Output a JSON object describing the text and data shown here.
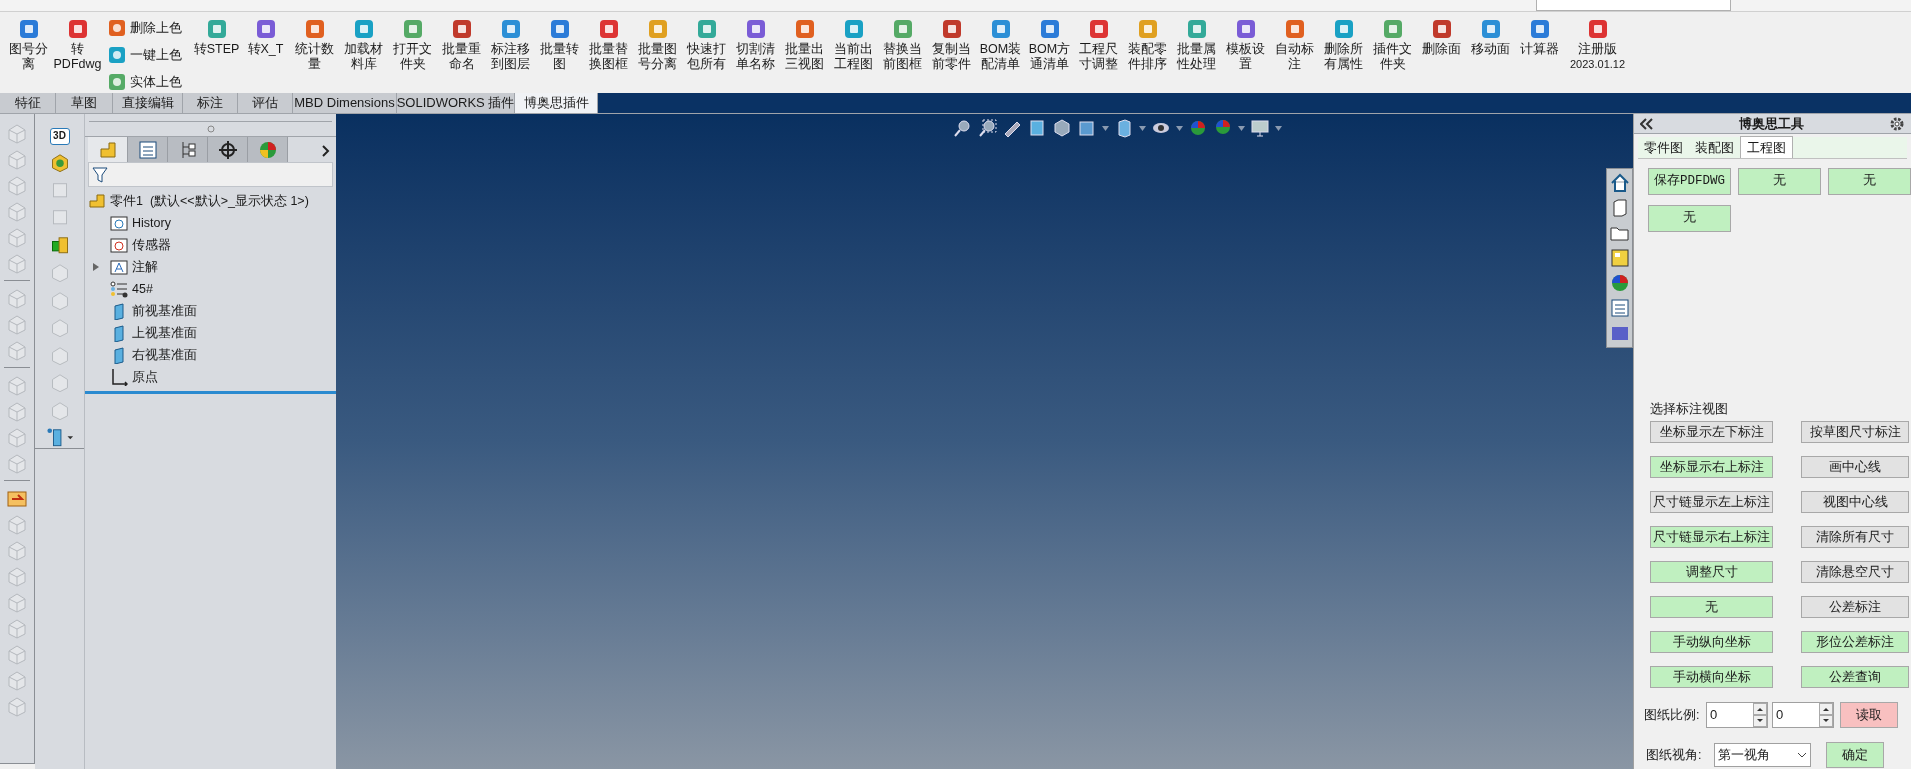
{
  "toolbar": {
    "items": [
      {
        "kind": "large",
        "lines": [
          "图号分",
          "离"
        ]
      },
      {
        "kind": "large",
        "lines": [
          "转",
          "PDFdwg"
        ]
      },
      {
        "kind": "stack",
        "items": [
          {
            "label": "删除上色"
          },
          {
            "label": "一键上色"
          },
          {
            "label": "实体上色"
          }
        ]
      },
      {
        "kind": "large",
        "lines": [
          "转STEP"
        ]
      },
      {
        "kind": "large",
        "lines": [
          "转X_T"
        ]
      },
      {
        "kind": "large",
        "lines": [
          "统计数",
          "量"
        ]
      },
      {
        "kind": "large",
        "lines": [
          "加载材",
          "料库"
        ]
      },
      {
        "kind": "large",
        "lines": [
          "打开文",
          "件夹"
        ]
      },
      {
        "kind": "large",
        "lines": [
          "批量重",
          "命名"
        ]
      },
      {
        "kind": "large",
        "lines": [
          "标注移",
          "到图层"
        ]
      },
      {
        "kind": "large",
        "lines": [
          "批量转",
          "图"
        ]
      },
      {
        "kind": "large",
        "lines": [
          "批量替",
          "换图框"
        ]
      },
      {
        "kind": "large",
        "lines": [
          "批量图",
          "号分离"
        ]
      },
      {
        "kind": "large",
        "lines": [
          "快速打",
          "包所有"
        ]
      },
      {
        "kind": "large",
        "lines": [
          "切割清",
          "单名称"
        ]
      },
      {
        "kind": "large",
        "lines": [
          "批量出",
          "三视图"
        ]
      },
      {
        "kind": "large",
        "lines": [
          "当前出",
          "工程图"
        ]
      },
      {
        "kind": "large",
        "lines": [
          "替换当",
          "前图框"
        ]
      },
      {
        "kind": "large",
        "lines": [
          "复制当",
          "前零件"
        ]
      },
      {
        "kind": "large",
        "lines": [
          "BOM装",
          "配清单"
        ]
      },
      {
        "kind": "large",
        "lines": [
          "BOM方",
          "通清单"
        ]
      },
      {
        "kind": "large",
        "lines": [
          "工程尺",
          "寸调整"
        ]
      },
      {
        "kind": "large",
        "lines": [
          "装配零",
          "件排序"
        ]
      },
      {
        "kind": "large",
        "lines": [
          "批量属",
          "性处理"
        ]
      },
      {
        "kind": "large",
        "lines": [
          "模板设",
          "置"
        ]
      },
      {
        "kind": "large",
        "lines": [
          "自动标",
          "注"
        ]
      },
      {
        "kind": "large",
        "lines": [
          "删除所",
          "有属性"
        ]
      },
      {
        "kind": "large",
        "lines": [
          "插件文",
          "件夹"
        ]
      },
      {
        "kind": "large",
        "lines": [
          "删除面"
        ]
      },
      {
        "kind": "large",
        "lines": [
          "移动面"
        ]
      },
      {
        "kind": "large",
        "lines": [
          "计算器"
        ]
      },
      {
        "kind": "large",
        "lines": [
          "注册版"
        ],
        "version": "2023.01.12"
      }
    ]
  },
  "ribbon_tabs": [
    {
      "label": "特征",
      "selected": false
    },
    {
      "label": "草图",
      "selected": false
    },
    {
      "label": "直接编辑",
      "selected": false
    },
    {
      "label": "标注",
      "selected": false
    },
    {
      "label": "评估",
      "selected": false
    },
    {
      "label": "MBD Dimensions",
      "selected": false
    },
    {
      "label": "SOLIDWORKS 插件",
      "selected": false
    },
    {
      "label": "博奥思插件",
      "selected": true
    }
  ],
  "left_tools": {
    "badge": "3D"
  },
  "feature_manager": {
    "tabs": [
      {
        "selected": true
      },
      {
        "selected": false
      },
      {
        "selected": false
      },
      {
        "selected": false
      },
      {
        "selected": false
      }
    ],
    "root": {
      "label": "零件1  (默认<<默认>_显示状态 1>)",
      "children": [
        {
          "label": "History",
          "has_children": false
        },
        {
          "label": "传感器",
          "has_children": false
        },
        {
          "label": "注解",
          "has_children": true
        },
        {
          "label": "45#",
          "has_children": false
        },
        {
          "label": "前视基准面",
          "has_children": false
        },
        {
          "label": "上视基准面",
          "has_children": false
        },
        {
          "label": "右视基准面",
          "has_children": false
        },
        {
          "label": "原点",
          "has_children": false
        }
      ]
    }
  },
  "task_pane": {
    "title": "博奥思工具",
    "tabs": [
      {
        "label": "零件图",
        "selected": false
      },
      {
        "label": "装配图",
        "selected": false
      },
      {
        "label": "工程图",
        "selected": true
      }
    ],
    "top_buttons": [
      {
        "label": "保存PDFDWG",
        "color": "#c0f0c0"
      },
      {
        "label": "无",
        "color": "#c0f0c0"
      },
      {
        "label": "无",
        "color": "#c0f0c0"
      },
      {
        "label": "无",
        "color": "#c0f0c0"
      }
    ],
    "section_label": "选择标注视图",
    "left_buttons": [
      {
        "label": "坐标显示左下标注",
        "color": "#e2e2e2"
      },
      {
        "label": "坐标显示右上标注",
        "color": "#c0f0c0"
      },
      {
        "label": "尺寸链显示左上标注",
        "color": "#e2e2e2"
      },
      {
        "label": "尺寸链显示右上标注",
        "color": "#c0f0c0"
      },
      {
        "label": "调整尺寸",
        "color": "#c0f0c0"
      },
      {
        "label": "无",
        "color": "#c0f0c0"
      },
      {
        "label": "手动纵向坐标",
        "color": "#c0f0c0"
      },
      {
        "label": "手动横向坐标",
        "color": "#c0f0c0"
      }
    ],
    "right_buttons": [
      {
        "label": "按草图尺寸标注",
        "color": "#e2e2e2"
      },
      {
        "label": "画中心线",
        "color": "#e2e2e2"
      },
      {
        "label": "视图中心线",
        "color": "#e2e2e2"
      },
      {
        "label": "清除所有尺寸",
        "color": "#e2e2e2"
      },
      {
        "label": "清除悬空尺寸",
        "color": "#e2e2e2"
      },
      {
        "label": "公差标注",
        "color": "#e2e2e2"
      },
      {
        "label": "形位公差标注",
        "color": "#c0f0c0"
      },
      {
        "label": "公差查询",
        "color": "#c0f0c0"
      }
    ],
    "scale": {
      "label": "图纸比例:",
      "value_1": "0",
      "value_2": "0",
      "button": {
        "label": "读取",
        "color": "#f8c0c0"
      }
    },
    "view": {
      "label": "图纸视角:",
      "value": "第一视角",
      "button": {
        "label": "确定",
        "color": "#c0f0c0"
      }
    }
  }
}
